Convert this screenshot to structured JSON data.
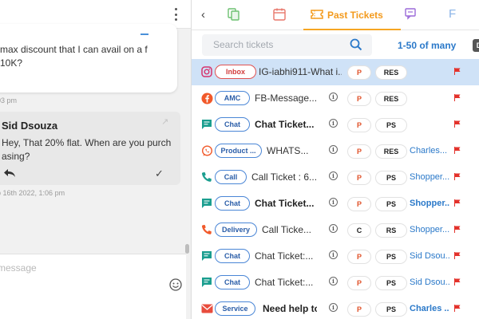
{
  "chat": {
    "message1": "max discount that I can avail on a f 10K?",
    "timestamp1": "03 pm",
    "sender": "Sid Dsouza",
    "message2": "Hey, That 20% flat. When are you purch asing?",
    "timestamp2": "b 16th 2022, 1:06 pm",
    "composer_placeholder": "message"
  },
  "tabs": {
    "back_icon": "chevron-left",
    "active_label": "Past Tickets",
    "next_partial": "F"
  },
  "search": {
    "placeholder": "Search tickets",
    "pagination": "1-50 of many",
    "badge": "D"
  },
  "colors": {
    "accent_orange": "#f39a1c",
    "link_blue": "#2b79c9",
    "selected_row": "#cfe2f7",
    "flag_red": "#e3322b"
  },
  "tickets": [
    {
      "icon": "instagram-icon",
      "channel": "Inbox",
      "title": "IG-iabhi911-What i...",
      "priority": "P",
      "status": "RES",
      "agent": ""
    },
    {
      "icon": "facebook-icon",
      "channel": "AMC",
      "title": "FB-Message...",
      "priority": "P",
      "status": "RES",
      "agent": ""
    },
    {
      "icon": "chat-icon",
      "channel": "Chat",
      "title": "Chat Ticket...",
      "priority": "P",
      "status": "PS",
      "agent": ""
    },
    {
      "icon": "whatsapp-icon",
      "channel": "Product ...",
      "title": "WHATS...",
      "priority": "P",
      "status": "RES",
      "agent": "Charles..."
    },
    {
      "icon": "phone-icon",
      "channel": "Call",
      "title": "Call Ticket : 6...",
      "priority": "P",
      "status": "PS",
      "agent": "Shopper..."
    },
    {
      "icon": "chat-icon",
      "channel": "Chat",
      "title": "Chat Ticket...",
      "priority": "P",
      "status": "PS",
      "agent": "Shopper..."
    },
    {
      "icon": "phone-icon",
      "channel": "Delivery",
      "title": "Call Ticke...",
      "priority": "C",
      "status": "RS",
      "agent": "Shopper..."
    },
    {
      "icon": "chat-icon",
      "channel": "Chat",
      "title": "Chat Ticket:...",
      "priority": "P",
      "status": "PS",
      "agent": "Sid Dsou..."
    },
    {
      "icon": "chat-icon",
      "channel": "Chat",
      "title": "Chat Ticket:...",
      "priority": "P",
      "status": "PS",
      "agent": "Sid Dsou..."
    },
    {
      "icon": "email-icon",
      "channel": "Service",
      "title": "Need help to",
      "priority": "P",
      "status": "PS",
      "agent": "Charles ..."
    }
  ]
}
